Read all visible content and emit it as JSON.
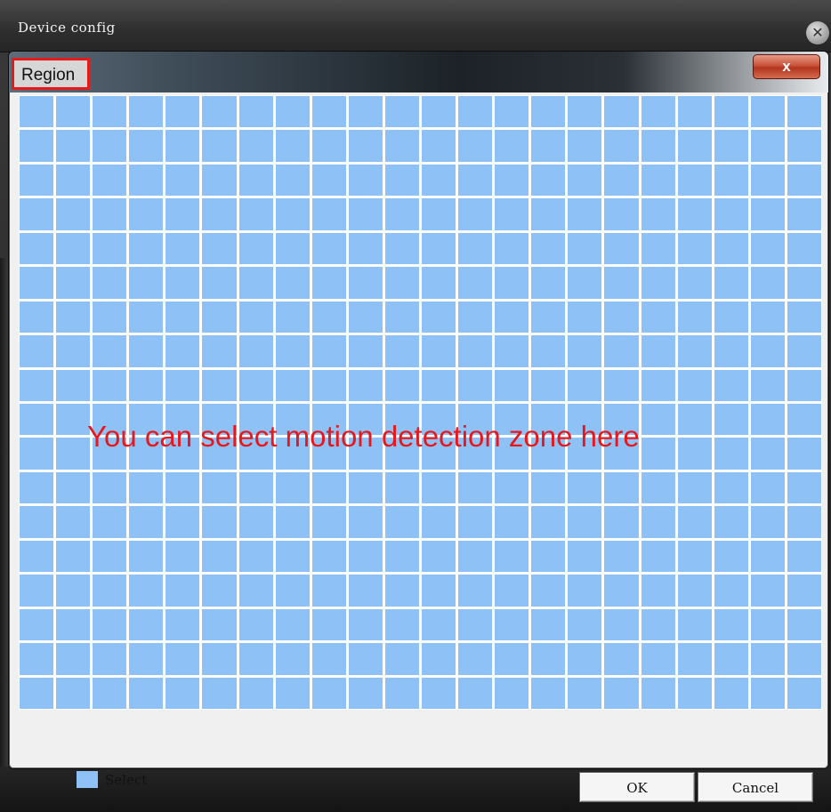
{
  "window": {
    "title": "Device config",
    "close_icon": "close-icon",
    "close_glyph": "✕"
  },
  "dialog": {
    "tab_label": "Region",
    "close_glyph": "x",
    "highlight_color": "#e51a1a"
  },
  "grid": {
    "columns": 22,
    "rows": 18,
    "selected_color": "#8ec2f7",
    "all_selected": true
  },
  "annotation": {
    "text": "You can select motion detection zone here",
    "color": "#e8171c"
  },
  "legend": {
    "label": "Select",
    "color": "#8ec2f7"
  },
  "buttons": {
    "ok_label": "OK",
    "cancel_label": "Cancel"
  }
}
